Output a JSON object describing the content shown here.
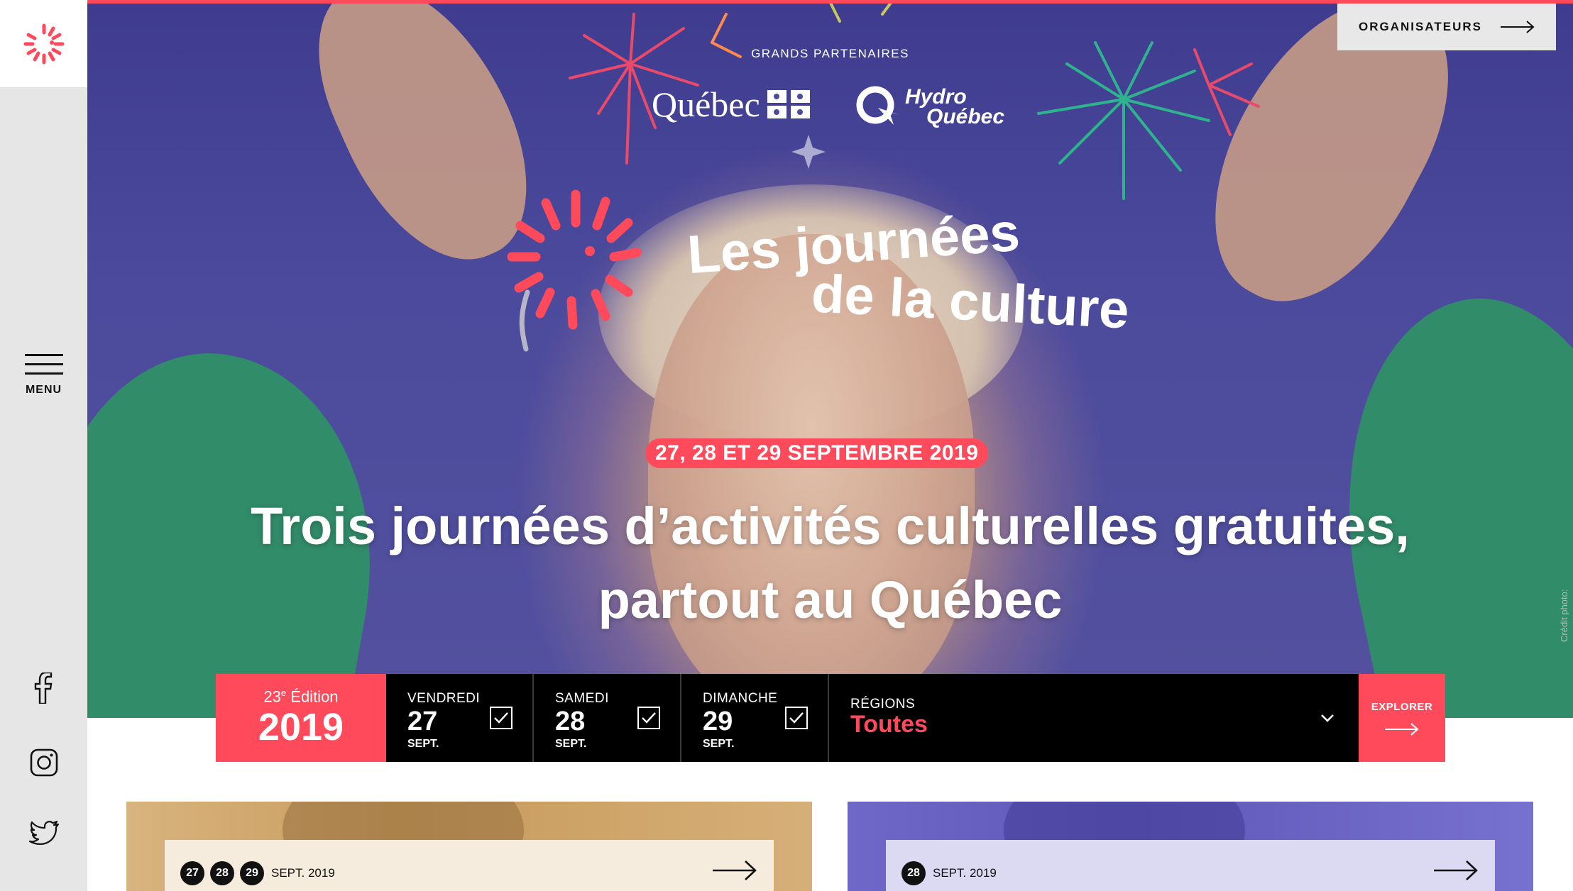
{
  "sidebar": {
    "menu_label": "MENU",
    "social": [
      "facebook-icon",
      "instagram-icon",
      "twitter-icon"
    ]
  },
  "header": {
    "organisateurs_label": "ORGANISATEURS",
    "partners_label": "GRANDS PARTENAIRES",
    "partner_1": "Québec",
    "partner_2_line1": "Hydro",
    "partner_2_line2": "Québec"
  },
  "hero": {
    "brand_line1": "Les journées",
    "brand_line2": "de la culture",
    "date_pill": "27, 28 ET 29 SEPTEMBRE 2019",
    "headline_line1": "Trois journées d’activités culturelles gratuites,",
    "headline_line2": "partout au Québec",
    "photo_credit": "Crédit photo:"
  },
  "filter": {
    "edition_number": "23",
    "edition_suffix": "e",
    "edition_word": " Édition",
    "edition_year": "2019",
    "days": [
      {
        "name": "VENDREDI",
        "num": "27",
        "month": "SEPT.",
        "checked": true
      },
      {
        "name": "SAMEDI",
        "num": "28",
        "month": "SEPT.",
        "checked": true
      },
      {
        "name": "DIMANCHE",
        "num": "29",
        "month": "SEPT.",
        "checked": true
      }
    ],
    "regions_label": "RÉGIONS",
    "regions_value": "Toutes",
    "explorer_label": "EXPLORER"
  },
  "cards": [
    {
      "dates": [
        "27",
        "28",
        "29"
      ],
      "text": "SEPT. 2019"
    },
    {
      "dates": [
        "28"
      ],
      "text": "SEPT. 2019"
    }
  ],
  "colors": {
    "accent": "#ff4a5c",
    "hero_bg": "#4b4a9c",
    "sleeve": "#2f8f67",
    "bar": "#000000"
  }
}
